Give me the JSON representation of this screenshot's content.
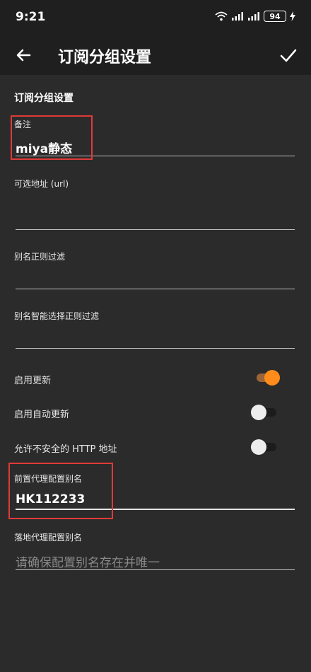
{
  "status": {
    "time": "9:21",
    "network": "ull ull",
    "battery": "94"
  },
  "appbar": {
    "title": "订阅分组设置",
    "back_icon": "arrow-left-icon",
    "save_icon": "check-icon"
  },
  "section": {
    "title": "订阅分组设置"
  },
  "fields": {
    "remark": {
      "label": "备注",
      "value": "miya静态"
    },
    "url": {
      "label": "可选地址 (url)",
      "value": ""
    },
    "alias_filter": {
      "label": "别名正则过滤",
      "value": ""
    },
    "smart_alias_filter": {
      "label": "别名智能选择正则过滤",
      "value": ""
    },
    "front_proxy": {
      "label": "前置代理配置别名",
      "value": "HK112233"
    },
    "landing_proxy": {
      "label": "落地代理配置别名",
      "placeholder": "请确保配置别名存在并唯一"
    }
  },
  "toggles": {
    "enable_update": {
      "label": "启用更新",
      "on": true
    },
    "auto_update": {
      "label": "启用自动更新",
      "on": false
    },
    "insecure_http": {
      "label": "允许不安全的 HTTP 地址",
      "on": false
    }
  },
  "colors": {
    "accent": "#ff8c1a",
    "highlight": "#e03a3a",
    "background": "#2b2b2b",
    "appbar": "#1f1f1f"
  }
}
